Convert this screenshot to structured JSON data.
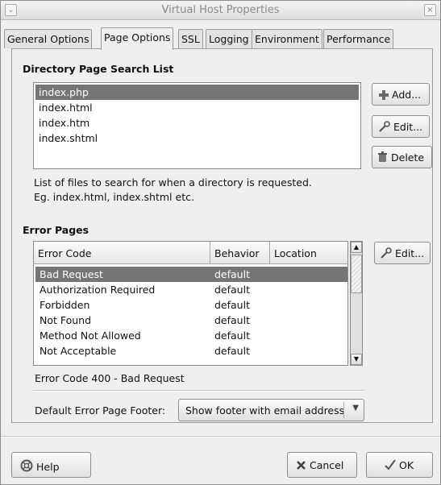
{
  "window": {
    "title": "Virtual Host Properties"
  },
  "tabs": [
    {
      "label": "General Options"
    },
    {
      "label": "Page Options"
    },
    {
      "label": "SSL"
    },
    {
      "label": "Logging"
    },
    {
      "label": "Environment"
    },
    {
      "label": "Performance"
    }
  ],
  "active_tab": "Page Options",
  "directory": {
    "title": "Directory Page Search List",
    "items": [
      "index.php",
      "index.html",
      "index.htm",
      "index.shtml"
    ],
    "selected": "index.php",
    "add_label": "Add...",
    "edit_label": "Edit...",
    "delete_label": "Delete",
    "help_line1": "List of files to search for when a directory is requested.",
    "help_line2": "Eg. index.html, index.shtml etc."
  },
  "error_pages": {
    "title": "Error Pages",
    "columns": [
      "Error Code",
      "Behavior",
      "Location"
    ],
    "rows": [
      {
        "code": "Bad Request",
        "behavior": "default",
        "location": ""
      },
      {
        "code": "Authorization Required",
        "behavior": "default",
        "location": ""
      },
      {
        "code": "Forbidden",
        "behavior": "default",
        "location": ""
      },
      {
        "code": "Not Found",
        "behavior": "default",
        "location": ""
      },
      {
        "code": "Method Not Allowed",
        "behavior": "default",
        "location": ""
      },
      {
        "code": "Not Acceptable",
        "behavior": "default",
        "location": ""
      }
    ],
    "selected": "Bad Request",
    "edit_label": "Edit...",
    "status": "Error Code 400 - Bad Request",
    "footer_label": "Default Error Page Footer:",
    "footer_value": "Show footer with email address"
  },
  "buttons": {
    "help": "Help",
    "cancel": "Cancel",
    "ok": "OK"
  },
  "colors": {
    "selection": "#757575",
    "window_bg": "#efefef",
    "title_text": "#8a8a8a"
  }
}
